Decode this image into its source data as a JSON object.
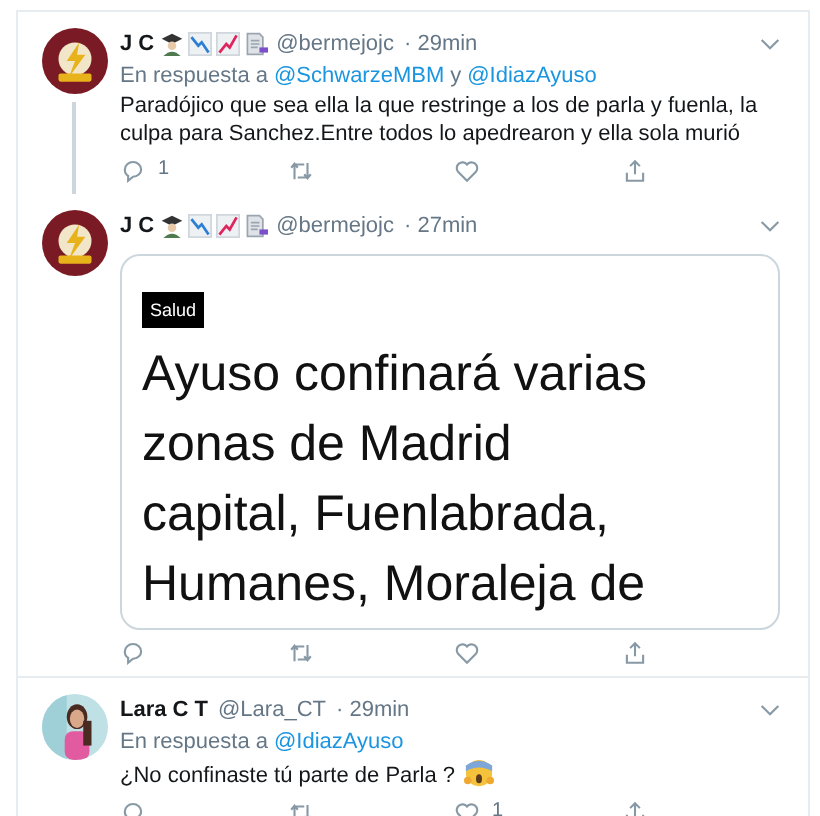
{
  "tweets": [
    {
      "name": "J C",
      "handle": "@bermejojc",
      "time": "· 29min",
      "avatar": {
        "kind": "logo"
      },
      "badges": [
        {
          "kind": "student"
        },
        {
          "kind": "chart-down"
        },
        {
          "kind": "chart-up"
        },
        {
          "kind": "memo"
        }
      ],
      "reply_to": {
        "label": "En respuesta a",
        "mentions": [
          "@SchwarzeMBM",
          "@IdiazAyuso"
        ],
        "joiner": "y"
      },
      "text": "Paradójico que sea ella la que restringe a los de parla y fuenla, la culpa para Sanchez.Entre todos lo apedrearon y ella sola murió",
      "reply_count": "1",
      "thread_below": true
    },
    {
      "name": "J C",
      "handle": "@bermejojc",
      "time": "· 27min",
      "avatar": {
        "kind": "logo"
      },
      "badges": [
        {
          "kind": "student"
        },
        {
          "kind": "chart-down"
        },
        {
          "kind": "chart-up"
        },
        {
          "kind": "memo"
        }
      ],
      "card": {
        "tag": "Salud",
        "headline": [
          "Ayuso confinará varias",
          "zonas de Madrid",
          "capital, Fuenlabrada,",
          "Humanes, Moraleja de"
        ]
      },
      "thread_below": false
    },
    {
      "name": "Lara C T",
      "handle": "@Lara_CT",
      "time": "· 29min",
      "reply_to": {
        "label": "En respuesta a",
        "mentions": [
          "@IdiazAyuso"
        ]
      },
      "text": "¿No confinaste tú parte de Parla ?",
      "emoji": {
        "kind": "scream"
      },
      "like_count": "1",
      "thread_below": false
    }
  ]
}
